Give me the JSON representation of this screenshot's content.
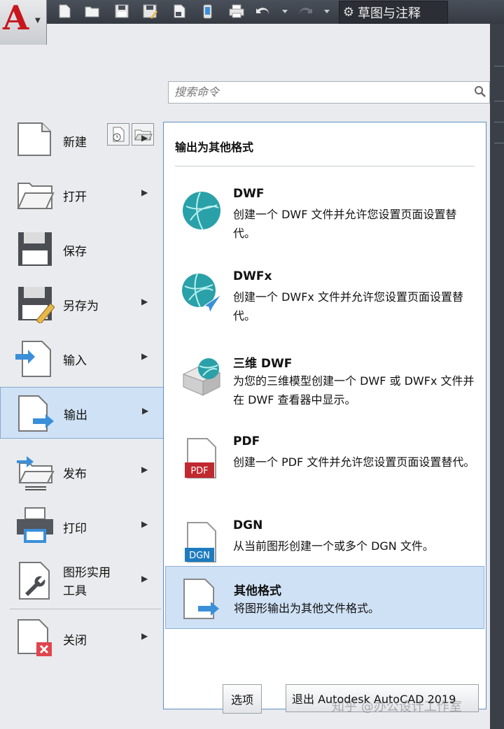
{
  "search": {
    "placeholder": "搜索命令"
  },
  "workspace": {
    "label": "草图与注释"
  },
  "left_menu": {
    "items": [
      {
        "label": "新建",
        "icon": "new-document-icon"
      },
      {
        "label": "打开",
        "icon": "open-folder-icon"
      },
      {
        "label": "保存",
        "icon": "save-disk-icon"
      },
      {
        "label": "另存为",
        "icon": "save-as-icon"
      },
      {
        "label": "输入",
        "icon": "import-icon"
      },
      {
        "label": "输出",
        "icon": "export-icon"
      },
      {
        "label": "发布",
        "icon": "publish-icon"
      },
      {
        "label": "打印",
        "icon": "printer-icon"
      },
      {
        "label": "图形实用工具",
        "label_line1": "图形实用",
        "label_line2": "工具",
        "icon": "drawing-utilities-icon"
      },
      {
        "label": "关闭",
        "icon": "close-document-icon"
      }
    ]
  },
  "submenu": {
    "title": "输出为其他格式",
    "items": [
      {
        "name": "DWF",
        "desc": "创建一个 DWF 文件并允许您设置页面设置替代。",
        "icon": "dwf-globe-icon"
      },
      {
        "name": "DWFx",
        "desc": "创建一个 DWFx 文件并允许您设置页面设置替代。",
        "icon": "dwfx-globe-icon"
      },
      {
        "name": "三维 DWF",
        "desc": "为您的三维模型创建一个 DWF 或 DWFx 文件并在 DWF 查看器中显示。",
        "icon": "3d-dwf-icon"
      },
      {
        "name": "PDF",
        "desc": "创建一个 PDF 文件并允许您设置页面设置替代。",
        "icon": "pdf-file-icon",
        "badge": "PDF"
      },
      {
        "name": "DGN",
        "desc": "从当前图形创建一个或多个 DGN 文件。",
        "icon": "dgn-file-icon",
        "badge": "DGN"
      },
      {
        "name": "其他格式",
        "desc": "将图形输出为其他文件格式。",
        "icon": "other-formats-icon"
      }
    ]
  },
  "buttons": {
    "options": "选项",
    "exit": "退出 Autodesk AutoCAD 2019"
  },
  "watermark": "知乎 @办公设计工作室",
  "colors": {
    "accent": "#3b8fd9",
    "highlight": "#cfe1f5",
    "brand_red": "#c8161d"
  }
}
